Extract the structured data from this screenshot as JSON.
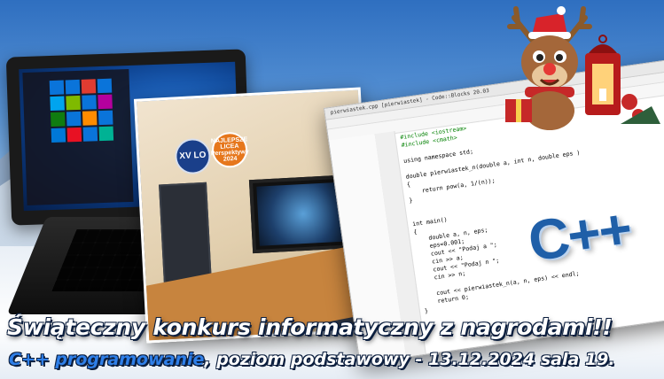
{
  "banner": {
    "headline": "Świąteczny konkurs informatyczny z nagrodami!!",
    "subline_accent": "C++ programowanie",
    "subline_rest": ", poziom podstawowy - 13.12.2024 sala 19."
  },
  "photo": {
    "badge_left": "XV LO",
    "badge_right": "NAJLEPSZE LICEA Perspektywy 2024"
  },
  "ide": {
    "title_bar": "pierwiastek.cpp [pierwiastek] - Code::Blocks 20.03",
    "code_lines": [
      "#include <iostream>",
      "#include <cmath>",
      "",
      "using namespace std;",
      "",
      "double pierwiastek_n(double a, int n, double eps )",
      "{",
      "    return pow(a, 1/(n));",
      "}",
      "",
      "",
      "int main()",
      "{",
      "    double a, n, eps;",
      "    eps=0.001;",
      "    cout << \"Podaj a \";",
      "    cin >> a;",
      "    cout << \"Podaj n \";",
      "    cin >> n;",
      "",
      "    cout << pierwiastek_n(a, n, eps) << endl;",
      "    return 0;",
      "}"
    ],
    "logo": "C++"
  },
  "colors": {
    "accent_blue": "#2f7fe8",
    "cpp_logo": "#1f5fa8"
  },
  "icons": [
    "laptop-icon",
    "reindeer-icon",
    "lantern-icon",
    "gift-icon"
  ]
}
